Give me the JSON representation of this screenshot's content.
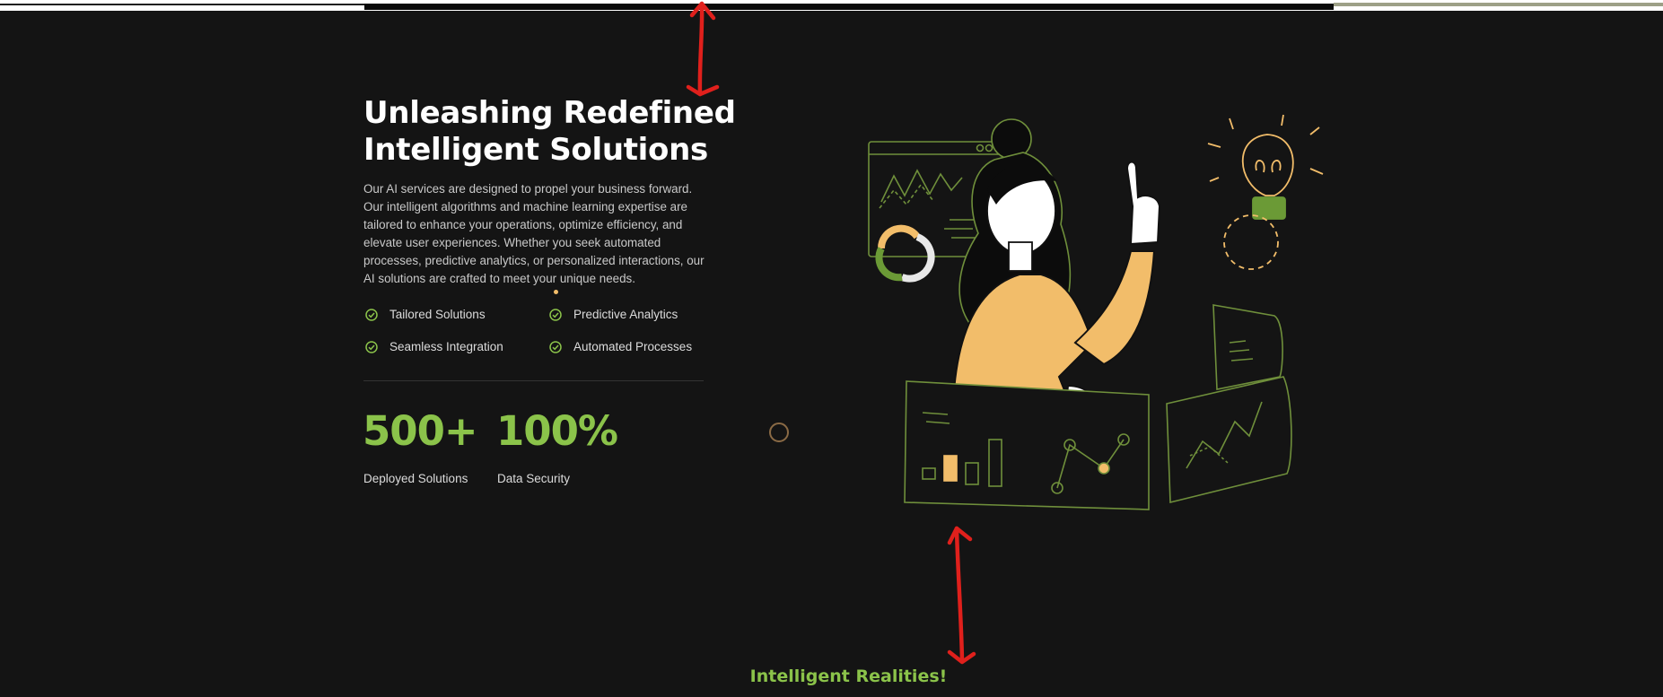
{
  "hero": {
    "title_line1": "Unleashing Redefined",
    "title_line2": "Intelligent Solutions",
    "description": "Our AI services are designed to propel your business forward. Our intelligent algorithms and machine learning expertise are tailored to enhance your operations, optimize efficiency, and elevate user experiences. Whether you seek automated processes, predictive analytics, or personalized interactions, our AI solutions are crafted to meet your unique needs.",
    "features": [
      {
        "label": "Tailored Solutions",
        "icon": "check-circle-icon"
      },
      {
        "label": "Predictive Analytics",
        "icon": "check-circle-icon"
      },
      {
        "label": "Seamless Integration",
        "icon": "check-circle-icon"
      },
      {
        "label": "Automated Processes",
        "icon": "check-circle-icon"
      }
    ],
    "stats": [
      {
        "value": "500+",
        "label": "Deployed Solutions"
      },
      {
        "value": "100%",
        "label": "Data Security"
      }
    ]
  },
  "next_section": {
    "title": "Intelligent Realities!"
  },
  "colors": {
    "background": "#141414",
    "accent_green": "#8bc34a",
    "accent_orange": "#f2bd6a",
    "annotation_red": "#e0201c",
    "text_light": "#dcdcdc"
  }
}
